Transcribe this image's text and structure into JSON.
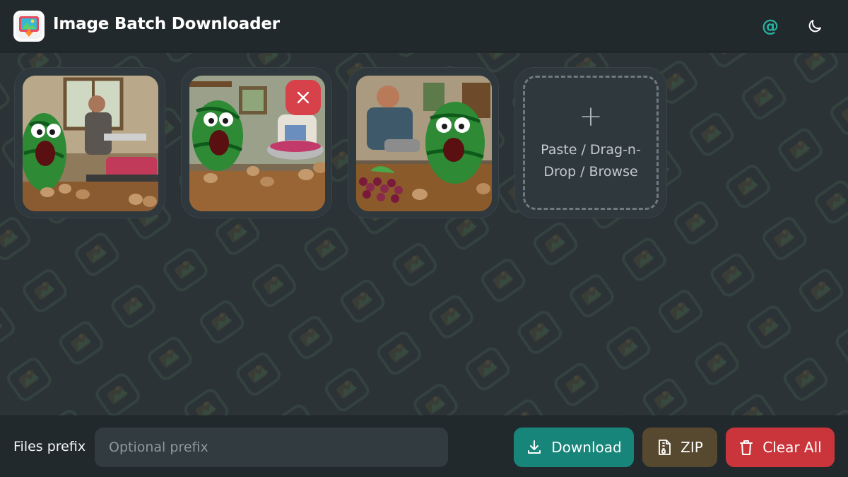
{
  "header": {
    "title": "Image Batch Downloader",
    "at_icon": "@",
    "icons": [
      "app-logo-icon",
      "at-sign-icon",
      "moon-icon"
    ]
  },
  "gallery": {
    "images": [
      {
        "name": "watermelon-chef-kitchen-1",
        "has_remove_button": false
      },
      {
        "name": "watermelon-chef-kitchen-2",
        "has_remove_button": true
      },
      {
        "name": "watermelon-chef-kitchen-3",
        "has_remove_button": false
      }
    ],
    "remove_icon": "close-icon",
    "drop_zone": {
      "plus": "+",
      "label": "Paste / Drag-n-Drop / Browse"
    }
  },
  "footer": {
    "prefix_label": "Files prefix",
    "prefix_placeholder": "Optional prefix",
    "prefix_value": "",
    "download_label": "Download",
    "zip_label": "ZIP",
    "clear_label": "Clear All"
  },
  "colors": {
    "accent": "#26b3a0",
    "download": "#18857a",
    "zip": "#56492f",
    "clear": "#c9353b",
    "remove": "#d7414a"
  }
}
